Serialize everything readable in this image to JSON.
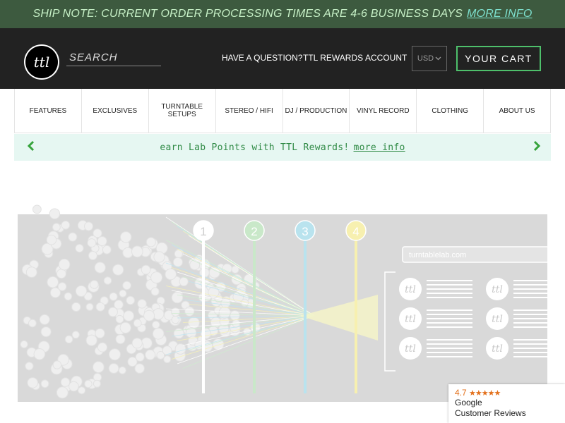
{
  "ship_bar": {
    "text": "SHIP NOTE: CURRENT ORDER PROCESSING TIMES ARE 4-6 BUSINESS DAYS",
    "link": "MORE INFO"
  },
  "header": {
    "logo_text": "ttl",
    "search_placeholder": "SEARCH",
    "links": [
      "HAVE A QUESTION?",
      "TTL REWARDS",
      "ACCOUNT"
    ],
    "currency": "USD",
    "cart_label": "YOUR CART"
  },
  "categories": [
    "FEATURES",
    "EXCLUSIVES",
    "TURNTABLE SETUPS",
    "STEREO / HIFI",
    "DJ / PRODUCTION",
    "VINYL RECORD",
    "CLOTHING",
    "ABOUT US"
  ],
  "promo": {
    "text": "earn Lab Points with TTL Rewards!",
    "link": "more info"
  },
  "hero": {
    "steps": [
      "1",
      "2",
      "3",
      "4"
    ],
    "step_colors": [
      "#ffffff",
      "#c9e8c9",
      "#b9e3ee",
      "#f7f0b0"
    ],
    "url_text": "turntablelab.com",
    "result_logo": "ttl"
  },
  "reviews": {
    "rating": "4.7",
    "stars": "★★★★★",
    "line1": "Google",
    "line2": "Customer Reviews"
  }
}
